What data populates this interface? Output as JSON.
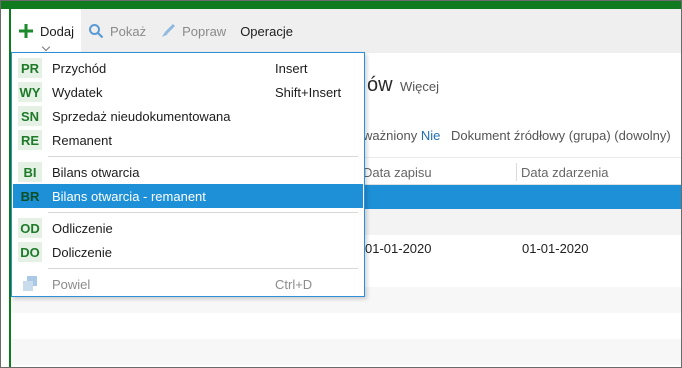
{
  "toolbar": {
    "add_label": "Dodaj",
    "show_label": "Pokaż",
    "edit_label": "Popraw",
    "operations_label": "Operacje"
  },
  "background": {
    "title_fragment": "ów",
    "more_label": "Więcej",
    "filter_approved_label": "ważniony",
    "filter_approved_value": "Nie",
    "filter_source_label": "Dokument źródłowy (grupa) (dowolny)",
    "columns": [
      "Data zapisu",
      "Data zdarzenia"
    ],
    "row": [
      "01-01-2020",
      "01-01-2020"
    ]
  },
  "menu": {
    "items": [
      {
        "code": "PR",
        "label": "Przychód",
        "shortcut": "Insert"
      },
      {
        "code": "WY",
        "label": "Wydatek",
        "shortcut": "Shift+Insert"
      },
      {
        "code": "SN",
        "label": "Sprzedaż nieudokumentowana",
        "shortcut": ""
      },
      {
        "code": "RE",
        "label": "Remanent",
        "shortcut": ""
      },
      {
        "code": "BI",
        "label": "Bilans otwarcia",
        "shortcut": ""
      },
      {
        "code": "BR",
        "label": "Bilans otwarcia - remanent",
        "shortcut": ""
      },
      {
        "code": "OD",
        "label": "Odliczenie",
        "shortcut": ""
      },
      {
        "code": "DO",
        "label": "Doliczenie",
        "shortcut": ""
      },
      {
        "code": "",
        "label": "Powiel",
        "shortcut": "Ctrl+D"
      }
    ]
  },
  "colors": {
    "accent_green": "#0f7a1e",
    "selection_blue": "#1e90d8",
    "badge_bg": "#e4f1e4"
  }
}
